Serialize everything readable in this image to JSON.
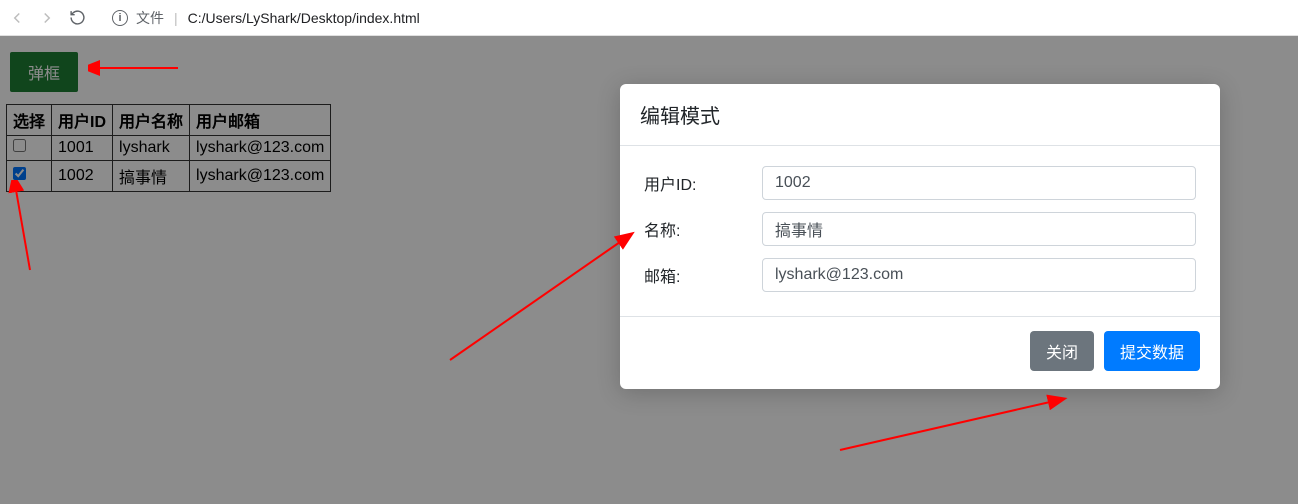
{
  "browser": {
    "url_prefix": "文件",
    "url_path": "C:/Users/LyShark/Desktop/index.html"
  },
  "button": {
    "popup_label": "弹框"
  },
  "table": {
    "headers": [
      "选择",
      "用户ID",
      "用户名称",
      "用户邮箱"
    ],
    "rows": [
      {
        "checked": false,
        "id": "1001",
        "name": "lyshark",
        "email": "lyshark@123.com"
      },
      {
        "checked": true,
        "id": "1002",
        "name": "搞事情",
        "email": "lyshark@123.com"
      }
    ]
  },
  "modal": {
    "title": "编辑模式",
    "labels": {
      "id": "用户ID:",
      "name": "名称:",
      "email": "邮箱:"
    },
    "values": {
      "id": "1002",
      "name": "搞事情",
      "email": "lyshark@123.com"
    },
    "close_label": "关闭",
    "submit_label": "提交数据"
  },
  "colors": {
    "primary": "#007bff",
    "secondary": "#6c757d",
    "success": "#1e7e34",
    "arrow": "#ff0000"
  }
}
